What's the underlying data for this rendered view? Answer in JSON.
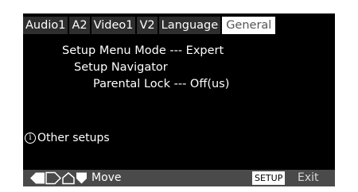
{
  "tabs": [
    "Audio1",
    "A2",
    "Video1",
    "V2",
    "Language",
    "General"
  ],
  "active_tab": "General",
  "settings": {
    "setup_menu_mode": "Setup Menu Mode --- Expert",
    "setup_navigator": "Setup Navigator",
    "parental_lock": "Parental Lock --- Off(us)"
  },
  "other_setups": {
    "icon": "info-icon",
    "label": "Other setups"
  },
  "footer": {
    "move_label": "Move",
    "setup_key": "SETUP",
    "exit_label": "Exit"
  }
}
